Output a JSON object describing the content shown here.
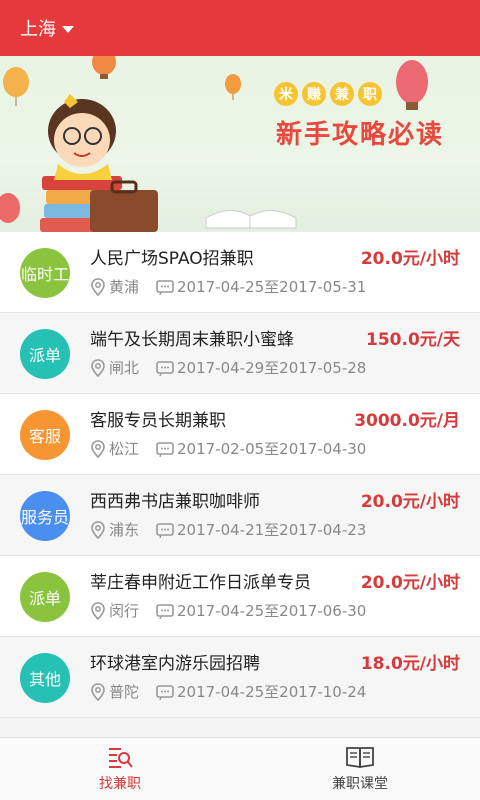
{
  "header": {
    "city": "上海"
  },
  "banner": {
    "tag_chars": [
      "米",
      "赚",
      "兼",
      "职"
    ],
    "title": "新手攻略必读"
  },
  "jobs": [
    {
      "badge": "临时工",
      "badge_color": "#8ac43f",
      "title": "人民广场SPAO招兼职",
      "price": "20.0元/小时",
      "district": "黄浦",
      "dates": "2017-04-25至2017-05-31"
    },
    {
      "badge": "派单",
      "badge_color": "#27c0b5",
      "title": "端午及长期周末兼职小蜜蜂",
      "price": "150.0元/天",
      "district": "闸北",
      "dates": "2017-04-29至2017-05-28"
    },
    {
      "badge": "客服",
      "badge_color": "#f79533",
      "title": "客服专员长期兼职",
      "price": "3000.0元/月",
      "district": "松江",
      "dates": "2017-02-05至2017-04-30"
    },
    {
      "badge": "服务员",
      "badge_color": "#4a8ef0",
      "title": "西西弗书店兼职咖啡师",
      "price": "20.0元/小时",
      "district": "浦东",
      "dates": "2017-04-21至2017-04-23"
    },
    {
      "badge": "派单",
      "badge_color": "#8ac43f",
      "title": "莘庄春申附近工作日派单专员",
      "price": "20.0元/小时",
      "district": "闵行",
      "dates": "2017-04-25至2017-06-30"
    },
    {
      "badge": "其他",
      "badge_color": "#27c0b5",
      "title": "环球港室内游乐园招聘",
      "price": "18.0元/小时",
      "district": "普陀",
      "dates": "2017-04-25至2017-10-24"
    }
  ],
  "tabs": [
    {
      "label": "找兼职",
      "icon": "search-list-icon",
      "active": true
    },
    {
      "label": "兼职课堂",
      "icon": "open-book-icon",
      "active": false
    }
  ],
  "colors": {
    "brand": "#e5393b",
    "price": "#d63a3a"
  }
}
